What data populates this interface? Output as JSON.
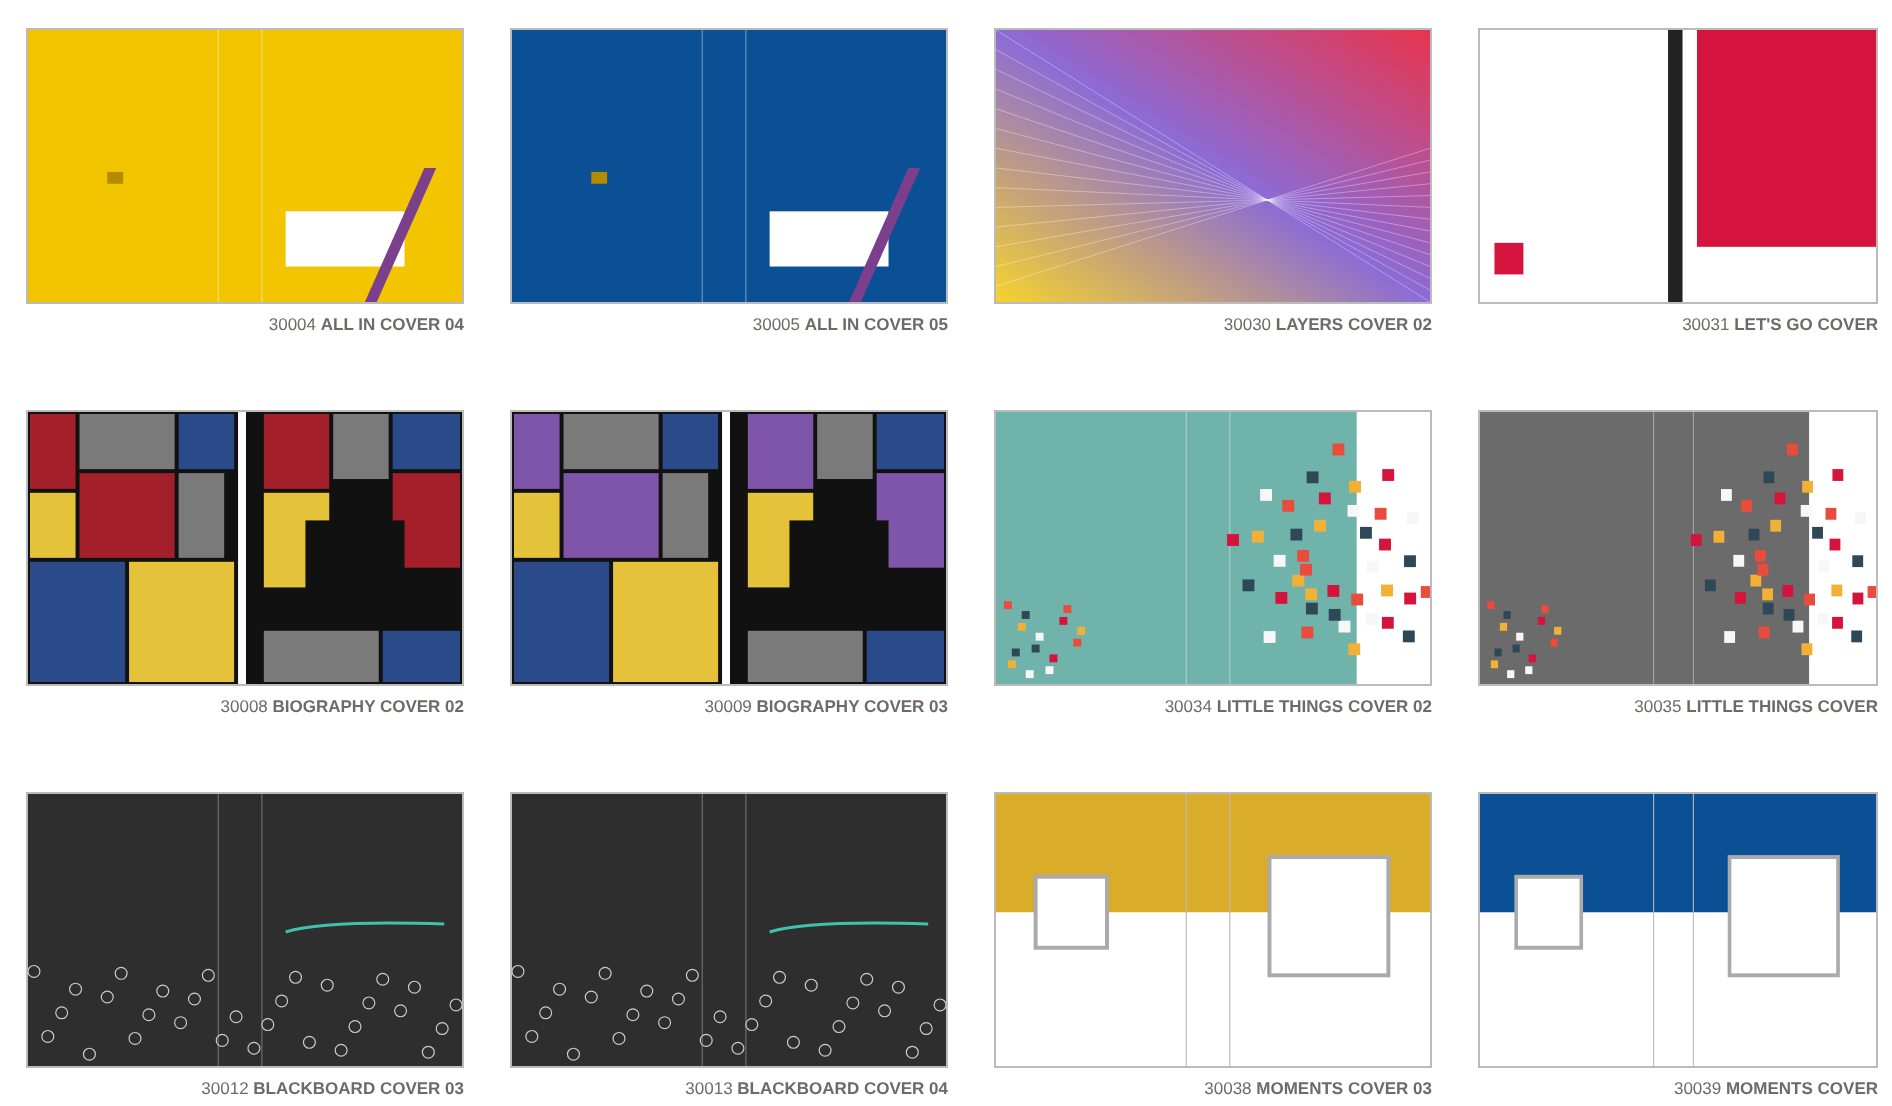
{
  "covers": [
    {
      "caption": "30004 **ALL IN COVER 04**",
      "kind": "solid",
      "color": "#f2c500"
    },
    {
      "caption": "30005 **ALL IN COVER 05**",
      "kind": "solid",
      "color": "#0b4f94"
    },
    {
      "caption": "30030 **LAYERS COVER 02**",
      "kind": "gradient",
      "color": "#e8344e"
    },
    {
      "caption": "30031 **LET'S GO COVER**",
      "kind": "split",
      "color": "#d4143c"
    },
    {
      "caption": "30008 **BIOGRAPHY COVER 02**",
      "kind": "mosaic",
      "color": "#a3202b"
    },
    {
      "caption": "30009 **BIOGRAPHY COVER 03**",
      "kind": "mosaic",
      "color": "#7e55a8"
    },
    {
      "caption": "30034 **LITTLE THINGS COVER 02**",
      "kind": "confetti",
      "color": "#6fb3aa"
    },
    {
      "caption": "30035 **LITTLE THINGS COVER**",
      "kind": "confetti",
      "color": "#6b6b6b"
    },
    {
      "caption": "30012 **BLACKBOARD COVER 03**",
      "kind": "chalk",
      "color": "#2e2e2e"
    },
    {
      "caption": "30013 **BLACKBOARD COVER 04**",
      "kind": "chalk",
      "color": "#2e2e2e"
    },
    {
      "caption": "30038 **MOMENTS COVER 03**",
      "kind": "band",
      "color": "#d9ac2a"
    },
    {
      "caption": "30039 **MOMENTS COVER**",
      "kind": "band",
      "color": "#0b4f94"
    }
  ]
}
